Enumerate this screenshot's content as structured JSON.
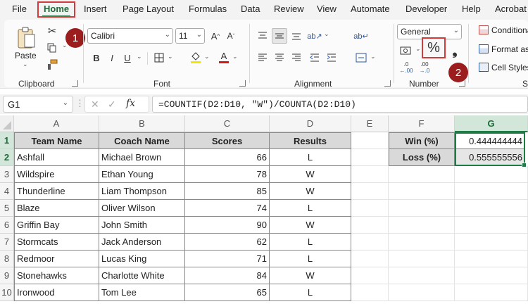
{
  "menu": {
    "items": [
      "File",
      "Home",
      "Insert",
      "Page Layout",
      "Formulas",
      "Data",
      "Review",
      "View",
      "Automate",
      "Developer",
      "Help",
      "Acrobat"
    ],
    "active": "Home"
  },
  "ribbon": {
    "clipboard": {
      "label": "Clipboard",
      "paste_label": "Paste"
    },
    "font": {
      "label": "Font",
      "font_name": "Calibri",
      "font_size": "11",
      "bold": "B",
      "italic": "I",
      "underline": "U",
      "grow": "A^",
      "shrink": "Aˇ"
    },
    "alignment": {
      "label": "Alignment"
    },
    "number": {
      "label": "Number",
      "format": "General",
      "percent": "%",
      "comma": "❟",
      "inc_decimal": ".00",
      "dec_decimal": ".0"
    },
    "styles": {
      "conditional": "Conditional",
      "format_as": "Format as",
      "cell_styles": "Cell Styles",
      "label_fragment": "St"
    },
    "step_markers": [
      "1",
      "2"
    ]
  },
  "formula_bar": {
    "name_box": "G1",
    "cancel": "✕",
    "enter": "✓",
    "fx": "fx",
    "formula": "=COUNTIF(D2:D10, \"W\")/COUNTA(D2:D10)"
  },
  "sheet": {
    "columns": [
      "A",
      "B",
      "C",
      "D",
      "E",
      "F",
      "G"
    ],
    "rows": [
      "1",
      "2",
      "3",
      "4",
      "5",
      "6",
      "7",
      "8",
      "9",
      "10"
    ],
    "table_headers": [
      "Team Name",
      "Coach Name",
      "Scores",
      "Results"
    ],
    "table_rows": [
      [
        "Ashfall",
        "Michael Brown",
        "66",
        "L"
      ],
      [
        "Wildspire",
        "Ethan Young",
        "78",
        "W"
      ],
      [
        "Thunderline",
        "Liam Thompson",
        "85",
        "W"
      ],
      [
        "Blaze",
        "Oliver Wilson",
        "74",
        "L"
      ],
      [
        "Griffin Bay",
        "John Smith",
        "90",
        "W"
      ],
      [
        "Stormcats",
        "Jack Anderson",
        "62",
        "L"
      ],
      [
        "Redmoor",
        "Lucas King",
        "71",
        "L"
      ],
      [
        "Stonehawks",
        "Charlotte White",
        "84",
        "W"
      ],
      [
        "Ironwood",
        "Tom Lee",
        "65",
        "L"
      ]
    ],
    "summary": [
      {
        "label": "Win (%)",
        "value": "0.444444444"
      },
      {
        "label": "Loss (%)",
        "value": "0.555555556"
      }
    ]
  },
  "colors": {
    "accent_green": "#1e7b45",
    "highlight_red": "#d23b3b",
    "marker_red": "#9b1d1d",
    "header_gray": "#d9d9d9"
  }
}
